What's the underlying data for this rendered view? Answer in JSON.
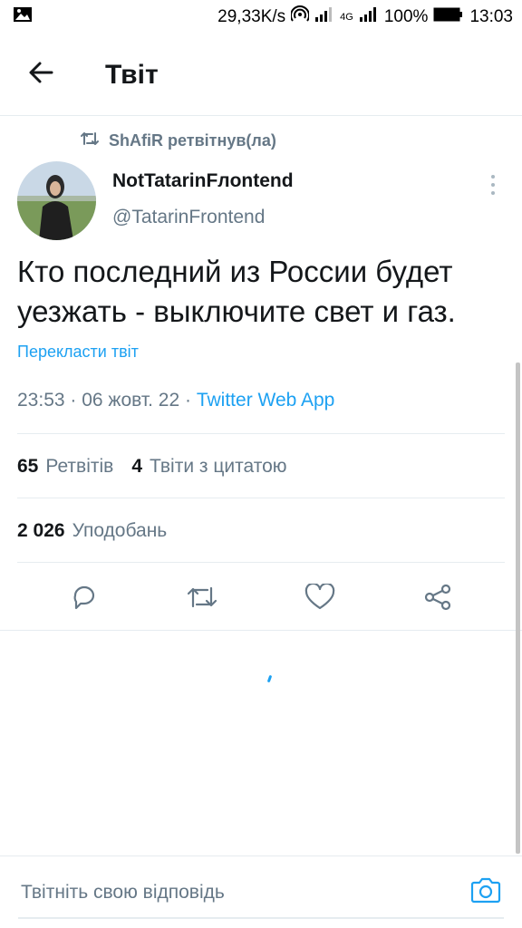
{
  "status_bar": {
    "speed": "29,33K/s",
    "network": "4G",
    "battery": "100%",
    "time": "13:03"
  },
  "header": {
    "title": "Твіт",
    "back_icon": "arrow-left-icon"
  },
  "retweet": {
    "text": "ShAfiR ретвітнув(ла)",
    "icon": "retweet-icon"
  },
  "tweet": {
    "author_name": "NotTatarinFлontend",
    "author_handle": "@TatarinFrontend",
    "text": "Кто последний из России будет уезжать - выключите свет и газ.",
    "translate_label": "Перекласти твіт",
    "time": "23:53",
    "date": "06 жовт. 22",
    "source": "Twitter Web App"
  },
  "stats": {
    "retweets_count": "65",
    "retweets_label": "Ретвітів",
    "quotes_count": "4",
    "quotes_label": "Твіти з цитатою",
    "likes_count": "2 026",
    "likes_label": "Уподобань"
  },
  "actions": [
    "reply-icon",
    "retweet-icon",
    "like-icon",
    "share-icon"
  ],
  "reply": {
    "placeholder": "Твітніть свою відповідь",
    "camera_icon": "camera-icon"
  },
  "colors": {
    "accent": "#1da1f2",
    "secondary_text": "#657786",
    "primary_text": "#14171a",
    "divider": "#e6ecf0"
  }
}
